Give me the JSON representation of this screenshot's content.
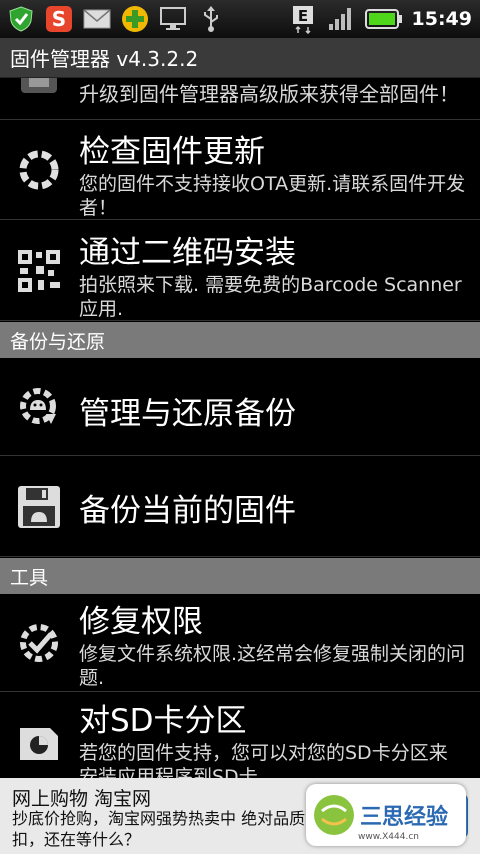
{
  "status_bar": {
    "icons": [
      "shield-check-icon",
      "sogou-input-icon",
      "mail-icon",
      "add-app-icon",
      "monitor-icon",
      "usb-icon"
    ],
    "indicators": [
      "e-network-icon",
      "signal-icon",
      "battery-icon"
    ],
    "time": "15:49"
  },
  "app": {
    "title": "固件管理器 v4.3.2.2"
  },
  "items": [
    {
      "title": "",
      "desc": "升级到固件管理器高级版来获得全部固件！"
    },
    {
      "title": "检查固件更新",
      "desc": "您的固件不支持接收OTA更新.请联系固件开发者！"
    },
    {
      "title": "通过二维码安装",
      "desc": "拍张照来下载. 需要免费的Barcode Scanner 应用."
    },
    {
      "title": "管理与还原备份",
      "desc": ""
    },
    {
      "title": "备份当前的固件",
      "desc": ""
    },
    {
      "title": "修复权限",
      "desc": "修复文件系统权限.这经常会修复强制关闭的问题."
    },
    {
      "title": "对SD卡分区",
      "desc": "若您的固件支持，您可以对您的SD卡分区来安装应用程序到SD卡."
    }
  ],
  "sections": {
    "backup": "备份与还原",
    "tools": "工具"
  },
  "ad": {
    "title": "网上购物 淘宝网",
    "text": "抄底价抢购，淘宝网强势热卖中 绝对品质扣，还在等什么？",
    "badge_name": "三思经验",
    "badge_url": "www.X444.cn"
  },
  "colors": {
    "section_bg": "#7a7a7a",
    "titlebar_bg": "#3a3a3a",
    "battery_green": "#4fd51a"
  }
}
